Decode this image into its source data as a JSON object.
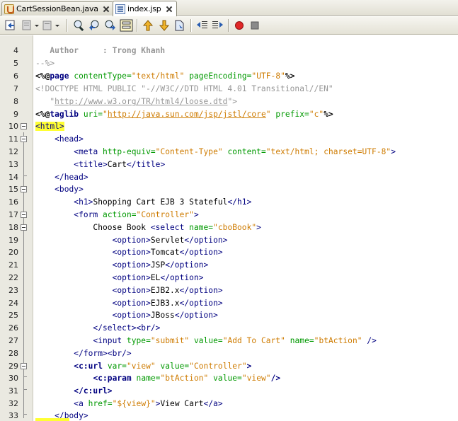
{
  "tabs": [
    {
      "label": "CartSessionBean.java",
      "icon": "java-file-icon",
      "active": false
    },
    {
      "label": "index.jsp",
      "icon": "jsp-file-icon",
      "active": true
    }
  ],
  "toolbar": {
    "buttons": [
      "back-icon",
      "forward-history-icon",
      "last-edit-icon",
      "find-selection-icon",
      "find-previous-icon",
      "find-next-icon",
      "toggle-highlight-icon",
      "previous-bookmark-icon",
      "next-bookmark-icon",
      "toggle-bookmark-icon",
      "shift-left-icon",
      "shift-right-icon",
      "start-macro-icon",
      "stop-macro-icon"
    ]
  },
  "editor": {
    "lines": [
      {
        "n": "4",
        "text": "   Author     : Trong Khanh"
      },
      {
        "n": "5",
        "text": "--%>"
      },
      {
        "n": "6",
        "text": "<%@page contentType=\"text/html\" pageEncoding=\"UTF-8\"%>"
      },
      {
        "n": "7",
        "text": "<!DOCTYPE HTML PUBLIC \"-//W3C//DTD HTML 4.01 Transitional//EN\""
      },
      {
        "n": "8",
        "text": "   \"http://www.w3.org/TR/html4/loose.dtd\">"
      },
      {
        "n": "9",
        "text": "<%@taglib uri=\"http://java.sun.com/jsp/jstl/core\" prefix=\"c\"%>"
      },
      {
        "n": "10",
        "text": "<html>"
      },
      {
        "n": "11",
        "text": "    <head>"
      },
      {
        "n": "12",
        "text": "        <meta http-equiv=\"Content-Type\" content=\"text/html; charset=UTF-8\">"
      },
      {
        "n": "13",
        "text": "        <title>Cart</title>"
      },
      {
        "n": "14",
        "text": "    </head>"
      },
      {
        "n": "15",
        "text": "    <body>"
      },
      {
        "n": "16",
        "text": "        <h1>Shopping Cart EJB 3 Stateful</h1>"
      },
      {
        "n": "17",
        "text": "        <form action=\"Controller\">"
      },
      {
        "n": "18",
        "text": "            Choose Book <select name=\"cboBook\">"
      },
      {
        "n": "19",
        "text": "                <option>Servlet</option>"
      },
      {
        "n": "20",
        "text": "                <option>Tomcat</option>"
      },
      {
        "n": "21",
        "text": "                <option>JSP</option>"
      },
      {
        "n": "22",
        "text": "                <option>EL</option>"
      },
      {
        "n": "23",
        "text": "                <option>EJB2.x</option>"
      },
      {
        "n": "24",
        "text": "                <option>EJB3.x</option>"
      },
      {
        "n": "25",
        "text": "                <option>JBoss</option>"
      },
      {
        "n": "26",
        "text": "            </select><br/>"
      },
      {
        "n": "27",
        "text": "            <input type=\"submit\" value=\"Add To Cart\" name=\"btAction\" />"
      },
      {
        "n": "28",
        "text": "        </form><br/>"
      },
      {
        "n": "29",
        "text": "        <c:url var=\"view\" value=\"Controller\">"
      },
      {
        "n": "30",
        "text": "            <c:param name=\"btAction\" value=\"view\"/>"
      },
      {
        "n": "31",
        "text": "        </c:url>"
      },
      {
        "n": "32",
        "text": "        <a href=\"${view}\">View Cart</a>"
      },
      {
        "n": "33",
        "text": "    </body>"
      }
    ]
  },
  "colors": {
    "tag": "#000080",
    "attribute": "#009900",
    "value": "#ce7b00",
    "comment": "#969696",
    "highlight": "#ffff33"
  }
}
